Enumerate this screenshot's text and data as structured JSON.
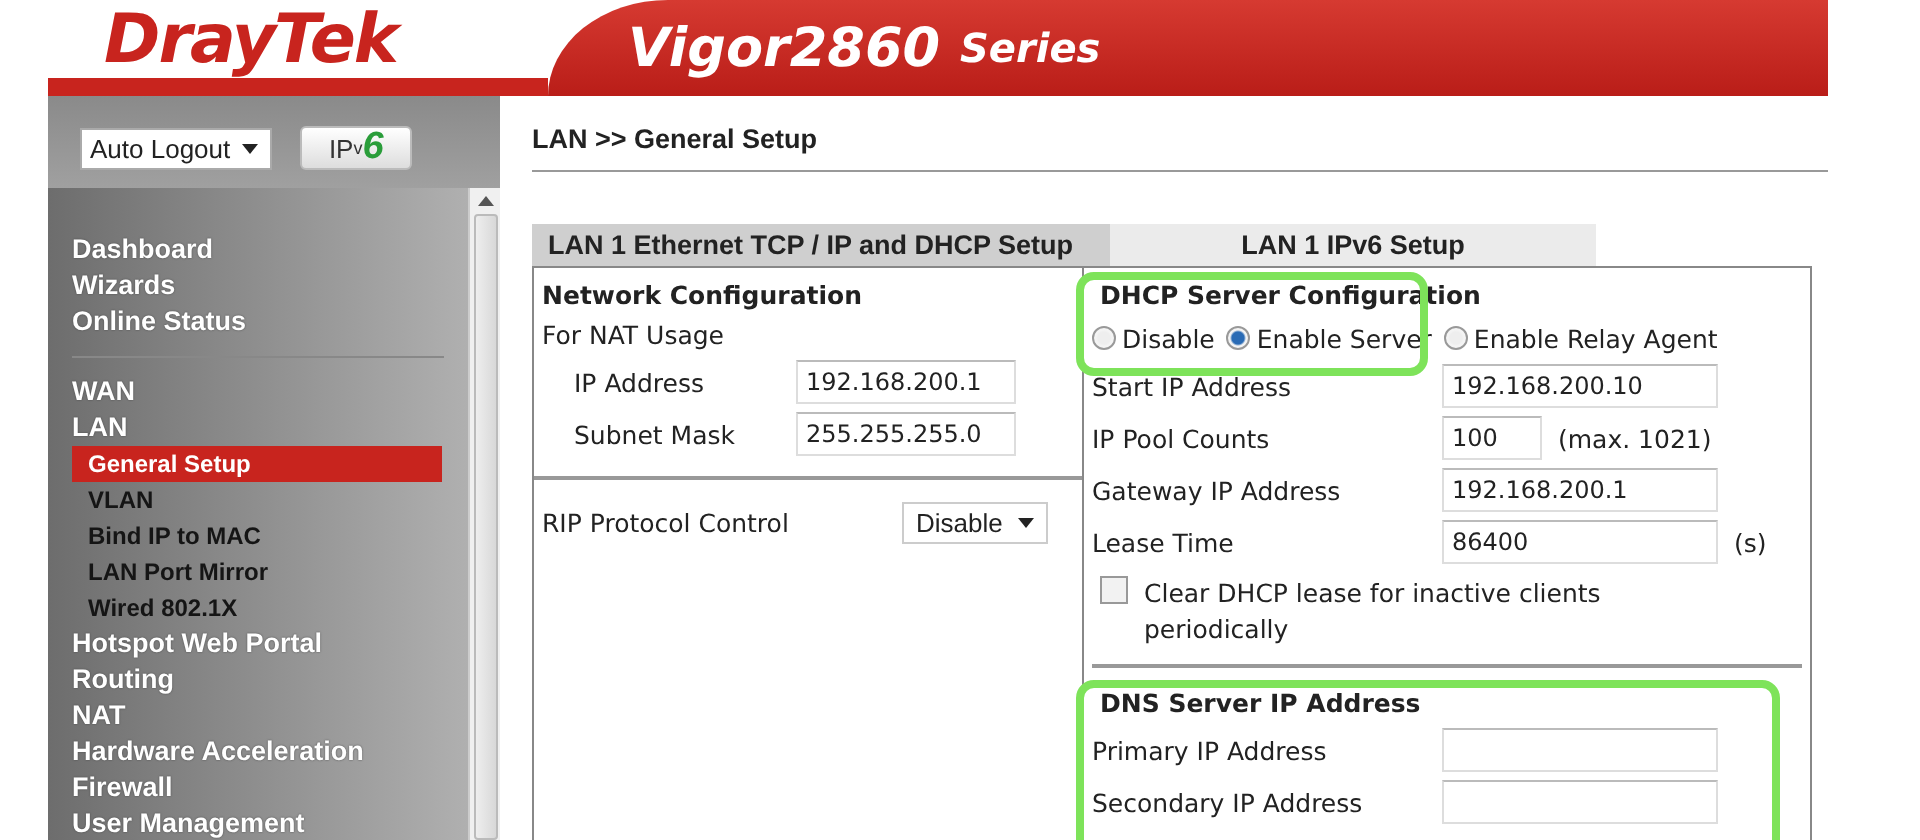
{
  "header": {
    "brand": "DrayTek",
    "model": "Vigor2860",
    "series": "Series"
  },
  "sidebar": {
    "auto_logout": "Auto Logout",
    "ipv6_logo": {
      "text": "IP",
      "sub": "v",
      "digit": "6"
    },
    "menu": [
      {
        "kind": "item",
        "label": "Dashboard",
        "selected": false
      },
      {
        "kind": "item",
        "label": "Wizards",
        "selected": false
      },
      {
        "kind": "item",
        "label": "Online Status",
        "selected": false
      },
      {
        "kind": "divider"
      },
      {
        "kind": "item",
        "label": "WAN",
        "selected": false
      },
      {
        "kind": "item",
        "label": "LAN",
        "selected": false,
        "children": [
          {
            "label": "General Setup",
            "selected": true
          },
          {
            "label": "VLAN",
            "selected": false
          },
          {
            "label": "Bind IP to MAC",
            "selected": false
          },
          {
            "label": "LAN Port Mirror",
            "selected": false
          },
          {
            "label": "Wired 802.1X",
            "selected": false
          }
        ]
      },
      {
        "kind": "item",
        "label": "Hotspot Web Portal",
        "selected": false
      },
      {
        "kind": "item",
        "label": "Routing",
        "selected": false
      },
      {
        "kind": "item",
        "label": "NAT",
        "selected": false
      },
      {
        "kind": "item",
        "label": "Hardware Acceleration",
        "selected": false
      },
      {
        "kind": "item",
        "label": "Firewall",
        "selected": false
      },
      {
        "kind": "item",
        "label": "User Management",
        "selected": false
      }
    ]
  },
  "breadcrumb": "LAN >> General Setup",
  "tabs": [
    {
      "label": "LAN 1 Ethernet TCP / IP and DHCP Setup",
      "selected": true
    },
    {
      "label": "LAN 1 IPv6 Setup",
      "selected": false
    }
  ],
  "network": {
    "title": "Network Configuration",
    "subtitle": "For NAT Usage",
    "fields": [
      {
        "label": "IP Address",
        "value": "192.168.200.1"
      },
      {
        "label": "Subnet Mask",
        "value": "255.255.255.0"
      }
    ],
    "rip": {
      "label": "RIP Protocol Control",
      "value": "Disable"
    }
  },
  "dhcp": {
    "title": "DHCP Server Configuration",
    "highlighted": true,
    "radios": [
      {
        "label": "Disable",
        "selected": false
      },
      {
        "label": "Enable Server",
        "selected": true
      },
      {
        "label": "Enable Relay Agent",
        "selected": false
      }
    ],
    "fields": [
      {
        "label": "Start IP Address",
        "value": "192.168.200.10",
        "kind": "wide"
      },
      {
        "label": "IP Pool Counts",
        "value": "100",
        "kind": "narrow",
        "suffix": "(max. 1021)"
      },
      {
        "label": "Gateway IP Address",
        "value": "192.168.200.1",
        "kind": "wide"
      },
      {
        "label": "Lease Time",
        "value": "86400",
        "kind": "wide",
        "suffix": "(s)"
      }
    ],
    "clear_lease": {
      "label": "Clear DHCP lease for inactive clients periodically",
      "checked": false
    }
  },
  "dns": {
    "title": "DNS Server IP Address",
    "highlighted": true,
    "fields": [
      {
        "label": "Primary IP Address"
      },
      {
        "label": "Secondary IP Address"
      }
    ]
  }
}
